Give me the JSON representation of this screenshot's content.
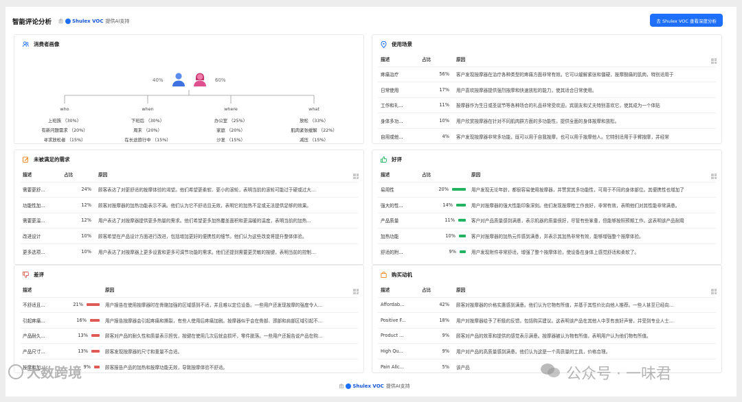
{
  "header": {
    "title": "智能评论分析",
    "powered_by": "由",
    "brand": "Shulex VOC",
    "powered_suffix": "提供AI支持",
    "deep_button": "去 Shulex VOC 查看深度分析"
  },
  "persona": {
    "title": "消费者画像",
    "male_pct": "40%",
    "female_pct": "60%",
    "dimensions": [
      {
        "name": "who",
        "items": [
          "上班族 （30%）",
          "有新问题需求 （20%）",
          "寻求放松者 （15%）"
        ]
      },
      {
        "name": "when",
        "items": [
          "下班后 （30%）",
          "周末 （20%）",
          "在长途旅行中 （15%）"
        ]
      },
      {
        "name": "where",
        "items": [
          "办公室 （25%）",
          "家庭 （20%）",
          "沙发 （15%）"
        ]
      },
      {
        "name": "what",
        "items": [
          "放松 （33%）",
          "肌肉紧张缓解 （22%）",
          "减压 （15%）"
        ]
      }
    ]
  },
  "usage": {
    "title": "使用场景",
    "columns": [
      "描述",
      "占比",
      "原因"
    ],
    "rows": [
      {
        "desc": "疼痛治疗",
        "pct": "56%",
        "reason": "客户发现按摩器在治疗各种类型的疼痛方面非常有效。它可以缓解紧张和僵硬，按摩酸痛的肌肉，特别适用于"
      },
      {
        "desc": "日常使用",
        "pct": "17%",
        "reason": "用户喜欢按摩器提供强烈按摩和快速放松的能力，使其适合日常使用。"
      },
      {
        "desc": "工作和礼...",
        "pct": "11%",
        "reason": "按摩器作为生日或圣诞节等各种场合的礼品非常受欢迎。宾朋友和丈夫特别喜欢它，使其成为一个体贴"
      },
      {
        "desc": "身体多功...",
        "pct": "10%",
        "reason": "用户欣赏按摩器在针对不同肌肉群方面的多功能性，提供全面的身体按摩和放松。"
      },
      {
        "desc": "自用或他...",
        "pct": "4%",
        "reason": "客户发现按摩器非常多功能，既可以用于自我按摩，也可以用于按摩他人。它特别适用于手臂按摩，并经常"
      }
    ]
  },
  "unmet": {
    "title": "未被满足的需求",
    "columns": [
      "描述",
      "占比",
      "原因"
    ],
    "rows": [
      {
        "desc": "需要更舒...",
        "pct": "24%",
        "reason": "顾客表达了对更舒适的按摩体验的渴望。他们希望更柔软、更小的滚轮，表明当前的滚轮可能过于硬或过大..."
      },
      {
        "desc": "功能性加...",
        "pct": "12%",
        "reason": "顾客对按摩器的加热功能表示不满。他们认为它不舒适且无效，表明它的加热不足或无法提供足够的效果。"
      },
      {
        "desc": "需要更温...",
        "pct": "12%",
        "reason": "用户表达了对按摩器提供更多热量的需求。他们希望更多加热覆盖面积和更温暖的温度，表明当前的加热..."
      },
      {
        "desc": "改进设计",
        "pct": "10%",
        "reason": "顾客希望在产品设计方面进行改进，包括增加更好的便携性的细节。他们认为这些改变将提升整体体验。"
      },
      {
        "desc": "更多选项...",
        "pct": "10%",
        "reason": "用户表达了对按摩器上更多设置和更多可调节功能的需求。他们还提到需要更灵敏的按键，表明当前的控制..."
      }
    ]
  },
  "positive": {
    "title": "好评",
    "columns": [
      "描述",
      "占比",
      "原因"
    ],
    "rows": [
      {
        "desc": "易用性",
        "pct": "20%",
        "level": 20,
        "reason": "用户发现无论年龄，都很容易使用按摩器，并赞赏其多功能性，可用于不同的身体部位。其便携性也增加了"
      },
      {
        "desc": "强大的性...",
        "pct": "14%",
        "level": 14,
        "reason": "用户对按摩器的强大性能印象深刻。他们发现按摩枪工作良好，非常有效，表明他们对其性能非常满意。"
      },
      {
        "desc": "产品质量",
        "pct": "11%",
        "level": 11,
        "reason": "客户对产品质量感到满意，表示机器的质量很好，尽管有些笨重，但能够按照预期工作。这表明该产品耐用"
      },
      {
        "desc": "加热功能",
        "pct": "10%",
        "level": 10,
        "reason": "客户对按摩器的加热元件感到满意，并表示其加热非常有效，能够增强整个按摩体验。"
      },
      {
        "desc": "舒适的附...",
        "pct": "9%",
        "level": 9,
        "reason": "用户发现附件非常舒适，增强了整个按摩体验，使设备在身体上感觉舒适和柔软了。"
      }
    ]
  },
  "negative": {
    "title": "差评",
    "columns": [
      "描述",
      "原因"
    ],
    "rows": [
      {
        "desc": "不舒适且...",
        "pct": "21%",
        "level": 21,
        "reason": "用户报告在使用按摩器时在骨骼加强的区域感到不适，并且难以定位设备。一些用户还发现按摩的强度令人..."
      },
      {
        "desc": "引起疼痛...",
        "pct": "16%",
        "level": 16,
        "reason": "用户报告按摩器会引起疼痛和撕裂，有些人使用后疼痛加剧。按摩器似乎会在骨部、颈部和肩部区域引起不..."
      },
      {
        "desc": "产品耐久...",
        "pct": "13%",
        "level": 13,
        "reason": "顾客对产品的耐久性和质量表示担忧，按键在使用几次后就会损坏，零件脱落。一些用户还报告说产品在购..."
      },
      {
        "desc": "产品尺寸...",
        "pct": "13%",
        "level": 13,
        "reason": "顾客发现按摩器的尺寸和重量不合适。"
      },
      {
        "desc": "按摩和加...",
        "pct": "9%",
        "level": 9,
        "reason": "顾客报告产品的加热和按摩功能无效，导致按摩体验不舒适。"
      }
    ]
  },
  "purchase": {
    "title": "购买动机",
    "columns": [
      "描述",
      "占比",
      "原因"
    ],
    "rows": [
      {
        "desc": "Affordab...",
        "pct": "42%",
        "reason": "顾客对按摩器的价格实惠感到满意。他们认为它物有所值，并基于其性价比向他人推荐。一些人甚至已经向..."
      },
      {
        "desc": "Positive F...",
        "pct": "18%",
        "reason": "用户对按摩器给予了积极的反馈，包括购买建议。这表明该产品在其他人中享有良好声誉，并受到专业人士..."
      },
      {
        "desc": "Product ...",
        "pct": "9%",
        "reason": "顾客对产品的效率和提供的感觉表示满意。按摩器被认为物有所值，表明用户认为他们物有所值。"
      },
      {
        "desc": "High Qu...",
        "pct": "9%",
        "reason": "用户对产品的高质量感到满意。他们认为这是一个高质量的工具，价格合理。"
      },
      {
        "desc": "Pain Allc...",
        "pct": "5%",
        "reason": "该产品"
      }
    ]
  },
  "footer": {
    "powered_by": "由",
    "brand": "Shulex VOC",
    "powered_suffix": "提供AI支持"
  },
  "watermarks": {
    "left": "大数跨境",
    "right": "公众号 · 一味君"
  },
  "colors": {
    "accent": "#1f6fff",
    "positive": "#21b35f",
    "negative": "#e05a55"
  }
}
